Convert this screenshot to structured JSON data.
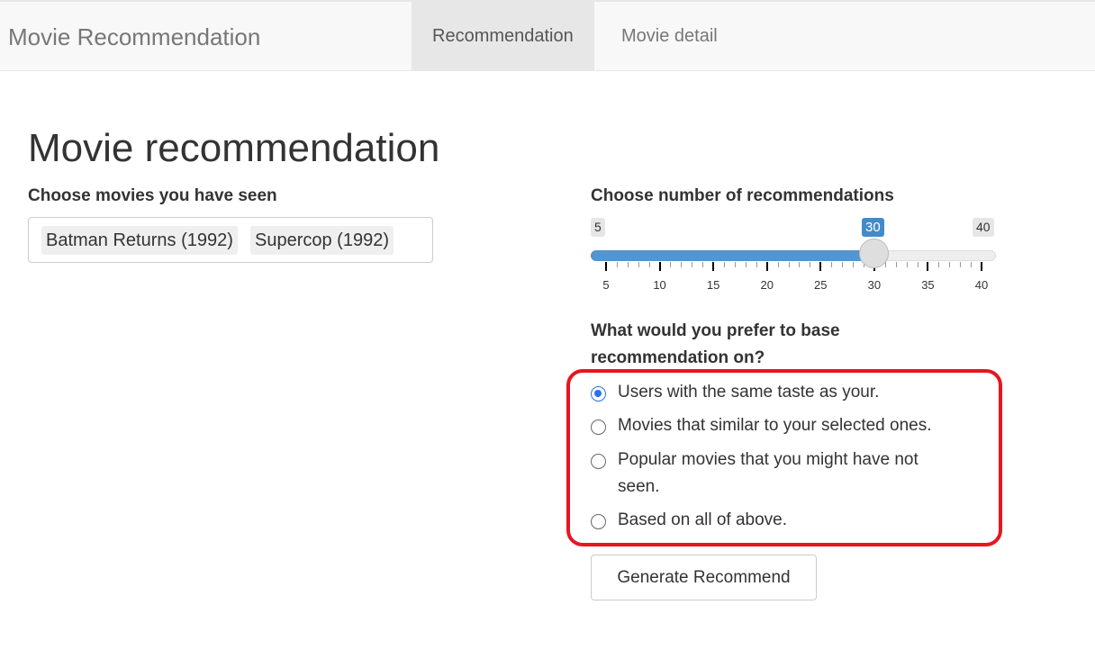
{
  "navbar": {
    "brand": "Movie Recommendation",
    "tabs": [
      {
        "label": "Recommendation",
        "active": true
      },
      {
        "label": "Movie detail",
        "active": false
      }
    ]
  },
  "page_title": "Movie recommendation",
  "movies": {
    "label": "Choose movies you have seen",
    "selected": [
      "Batman Returns (1992)",
      "Supercop (1992)"
    ]
  },
  "slider": {
    "label": "Choose number of recommendations",
    "min": "5",
    "max": "40",
    "value": "30",
    "ticks": [
      "5",
      "10",
      "15",
      "20",
      "25",
      "30",
      "35",
      "40"
    ],
    "accent": "#428bca"
  },
  "basis": {
    "label_line1": "What would you prefer to base",
    "label_line2": "recommendation on?",
    "options": [
      {
        "line1": "Users with the same taste as your.",
        "line2": "",
        "checked": true
      },
      {
        "line1": "Movies that similar to your selected ones.",
        "line2": "",
        "checked": false
      },
      {
        "line1": "Popular movies that you might have not",
        "line2": "seen.",
        "checked": false
      },
      {
        "line1": "Based on all of above.",
        "line2": "",
        "checked": false
      }
    ]
  },
  "generate_button": "Generate Recommend"
}
